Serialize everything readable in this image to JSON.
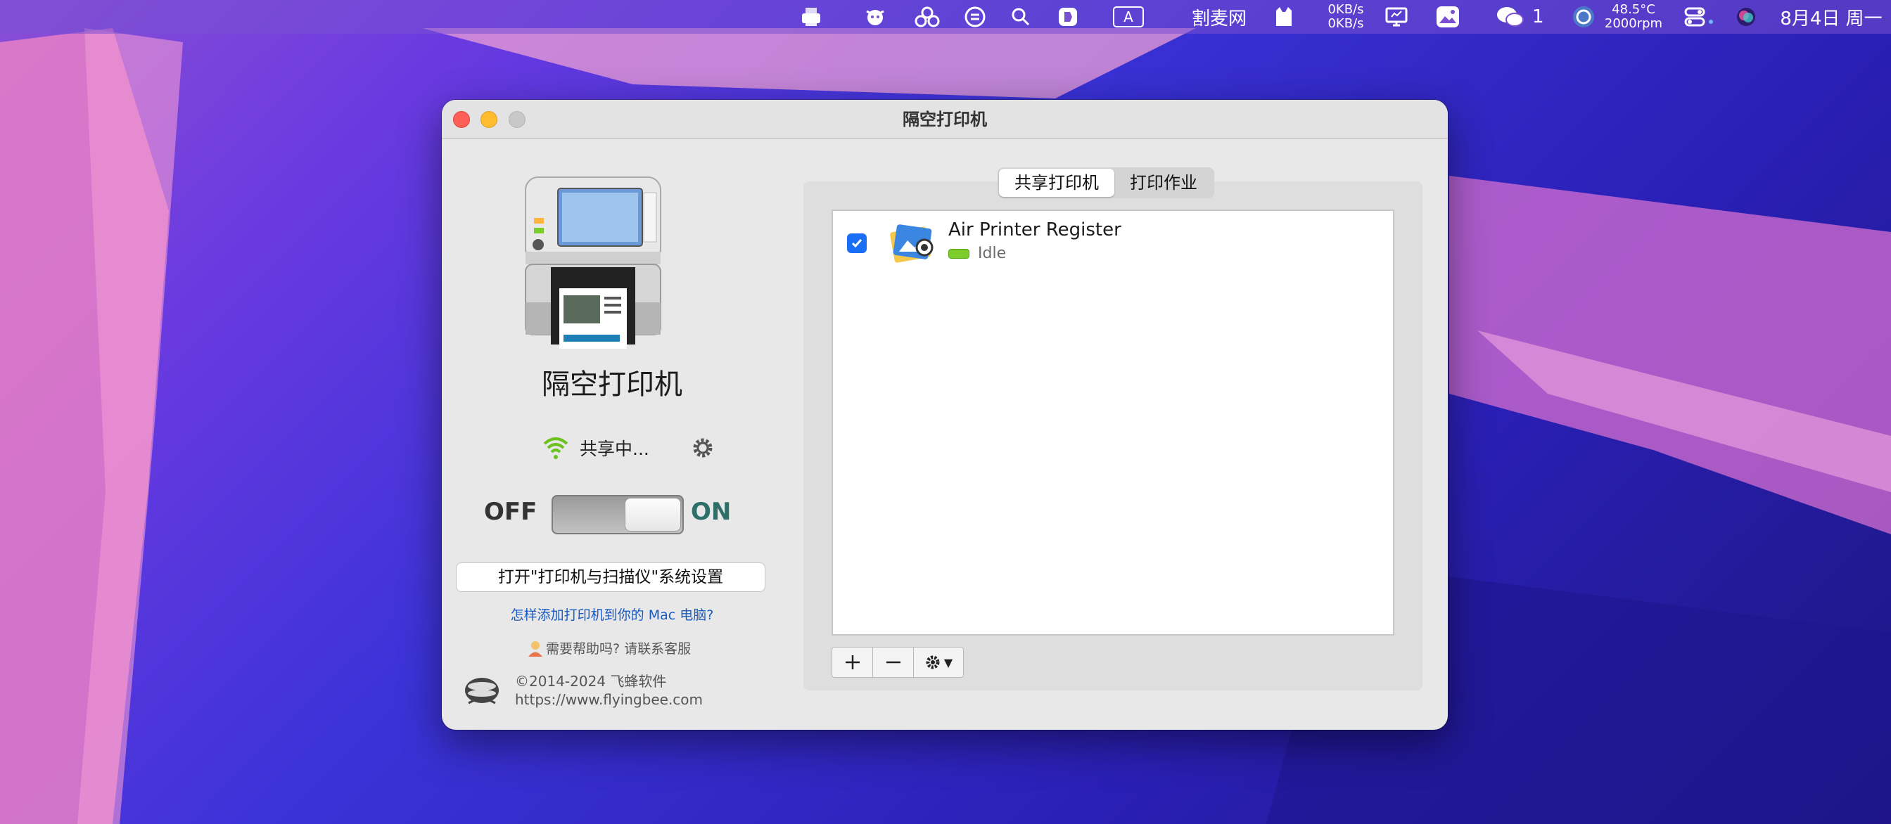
{
  "menubar": {
    "app_name": "割麦网",
    "net_up": "0KB/s",
    "net_down": "0KB/s",
    "temp": "48.5°C",
    "fan": "2000rpm",
    "wechat_count": "1",
    "datetime": "8月4日 周一",
    "input_method": "A",
    "icons": [
      "printer-icon",
      "cow-icon",
      "connection-icon",
      "switch-icon",
      "search-icon",
      "bookmark-icon",
      "input-method-icon",
      "cat-icon",
      "monitor-icon",
      "photo-icon",
      "wechat-icon",
      "cpu-icon",
      "control-center-icon",
      "siri-icon"
    ]
  },
  "window": {
    "title": "隔空打印机"
  },
  "left": {
    "app_name": "隔空打印机",
    "sharing_status": "共享中...",
    "off_label": "OFF",
    "on_label": "ON",
    "toggle_on": true,
    "open_settings_button": "打开\"打印机与扫描仪\"系统设置",
    "how_to_link": "怎样添加打印机到你的 Mac 电脑?",
    "help_text": "需要帮助吗?  请联系客服",
    "copyright": "©2014-2024 飞蜂软件",
    "website": "https://www.flyingbee.com"
  },
  "tabs": [
    {
      "label": "共享打印机",
      "active": true
    },
    {
      "label": "打印作业",
      "active": false
    }
  ],
  "printers": [
    {
      "name": "Air Printer Register",
      "status": "Idle",
      "checked": true
    }
  ],
  "toolbar": {
    "add": "+",
    "remove": "−",
    "action": "▼"
  },
  "colors": {
    "accent": "#1a6ef5",
    "status_green": "#7ccd2a",
    "on_label": "#2f6f6a",
    "link": "#1a5bc2"
  }
}
